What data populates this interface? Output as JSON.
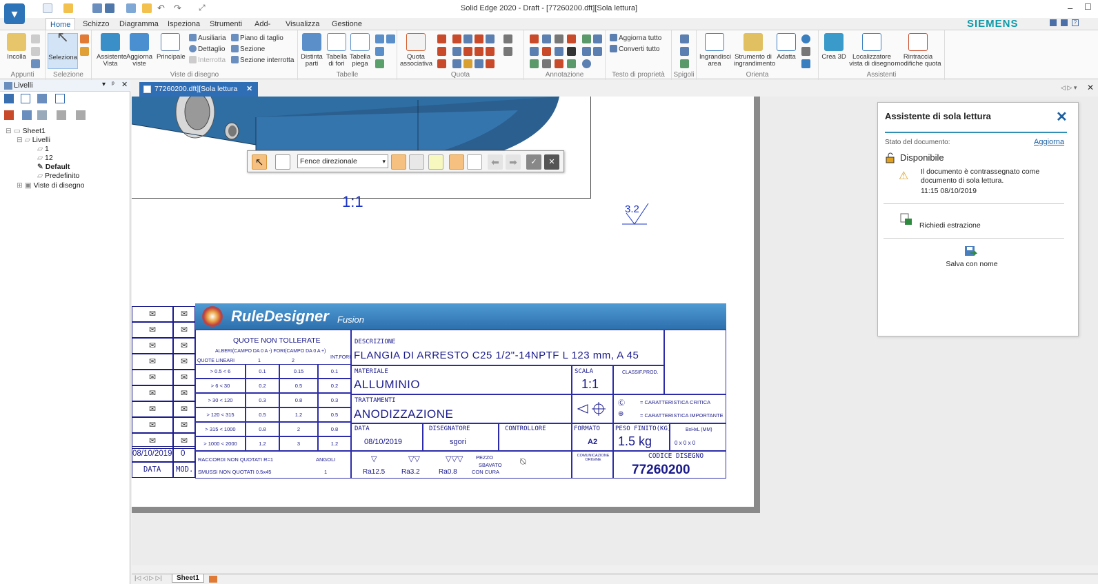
{
  "window": {
    "title": "Solid Edge 2020 - Draft - [77260200.dft][Sola lettura]",
    "brand": "SIEMENS"
  },
  "tabs": [
    "Home",
    "Schizzo",
    "Diagramma",
    "Ispeziona",
    "Strumenti",
    "Add-in",
    "Visualizza",
    "Gestione dati"
  ],
  "ribbon": {
    "appunti": {
      "label": "Appunti",
      "incolla": "Incolla"
    },
    "selezione": {
      "label": "Selezione",
      "seleziona": "Seleziona"
    },
    "viste": {
      "label": "Viste di disegno",
      "assistente": "Assistente Vista",
      "aggiorna": "Aggiorna viste",
      "principale": "Principale",
      "ausiliaria": "Ausiliaria",
      "dettaglio": "Dettaglio",
      "interrotta": "Interrotta",
      "piano": "Piano di taglio",
      "sezione": "Sezione",
      "sez_interrotta": "Sezione interrotta"
    },
    "tabelle": {
      "label": "Tabelle",
      "distinta": "Distinta parti",
      "fori": "Tabella di fori",
      "piega": "Tabella piega"
    },
    "quota": {
      "label": "Quota",
      "associativa": "Quota associativa"
    },
    "annotazione": {
      "label": "Annotazione"
    },
    "testo": {
      "label": "Testo di proprietà",
      "aggiorna_tutto": "Aggiorna tutto",
      "converti_tutto": "Converti tutto"
    },
    "spigoli": {
      "label": "Spigoli"
    },
    "orienta": {
      "label": "Orienta",
      "ingrandisci": "Ingrandisci area",
      "strumento": "Strumento di ingrandimento",
      "adatta": "Adatta"
    },
    "assistenti": {
      "label": "Assistenti",
      "crea3d": "Crea 3D",
      "localizzatore": "Localizzatore vista di disegno",
      "rintraccia": "Rintraccia modifiche quota"
    }
  },
  "layers_panel": {
    "title": "Livelli",
    "tree": [
      "Sheet1",
      "Livelli",
      "1",
      "12",
      "Default",
      "Predefinito",
      "Viste di disegno"
    ]
  },
  "doc_tab": "77260200.dft][Sola lettura",
  "command_bar": {
    "fence": "Fence direzionale"
  },
  "drawing": {
    "view_scale": "1:1",
    "roughness": "3.2",
    "title_block": {
      "logo": "RuleDesigner",
      "logo_sub": "Fusion",
      "tol_title": "QUOTE NON TOLLERATE",
      "tol_sub": "ALBERI(CAMPO DA 0 A -) FORI(CAMPO DA 0 A +)",
      "tol_headers": [
        "QUOTE LINEARI",
        "1",
        "2",
        "INT.FORI"
      ],
      "tol_rows": [
        [
          "> 0.5 < 6",
          "0.1",
          "0.15",
          "0.1"
        ],
        [
          "> 6 < 30",
          "0.2",
          "0.5",
          "0.2"
        ],
        [
          "> 30 < 120",
          "0.3",
          "0.8",
          "0.3"
        ],
        [
          "> 120 < 315",
          "0.5",
          "1.2",
          "0.5"
        ],
        [
          "> 315 < 1000",
          "0.8",
          "2",
          "0.8"
        ],
        [
          "> 1000 < 2000",
          "1.2",
          "3",
          "1.2"
        ]
      ],
      "raccordi": "RACCORDI NON QUOTATI R=1",
      "smussi": "SMUSSI NON QUOTATI 0.5x45",
      "angoli": "ANGOLI",
      "angoli_val": "1",
      "rev_date": "08/10/2019",
      "rev_num": "0",
      "rev_data_lbl": "DATA",
      "rev_mod_lbl": "MOD.",
      "descrizione_lbl": "DESCRIZIONE",
      "descrizione": "FLANGIA DI ARRESTO C25 1/2\"-14NPTF L 123 mm, A 45",
      "materiale_lbl": "MATERIALE",
      "materiale": "ALLUMINIO",
      "scala_lbl": "SCALA",
      "scala": "1:1",
      "classif_lbl": "CLASSIF.PROD.",
      "trattamenti_lbl": "TRATTAMENTI",
      "trattamento": "ANODIZZAZIONE",
      "critica": "= CARATTERISTICA CRITICA",
      "importante": "= CARATTERISTICA IMPORTANTE",
      "data_lbl": "DATA",
      "data": "08/10/2019",
      "disegnatore_lbl": "DISEGNATORE",
      "disegnatore": "sgori",
      "controllore_lbl": "CONTROLLORE",
      "formato_lbl": "FORMATO",
      "formato": "A2",
      "peso_lbl": "PESO FINITO(KG)",
      "peso": "1.5 kg",
      "bxhxl_lbl": "BxHxL (MM)",
      "bxhxl": "0  x  0  x  0",
      "comunicazione": "COMUNICAZIONE ORIGINE",
      "codice_lbl": "CODICE DISEGNO",
      "codice": "77260200",
      "ra": [
        "Ra12.5",
        "Ra3.2",
        "Ra0.8"
      ],
      "pezzo": [
        "PEZZO",
        "SBAVATO",
        "CON CURA"
      ]
    }
  },
  "assistant": {
    "title": "Assistente di sola lettura",
    "state_lbl": "Stato del documento:",
    "refresh": "Aggiorna",
    "status": "Disponibile",
    "message": "Il documento è contrassegnato come documento di sola lettura.",
    "time": "11:15  08/10/2019",
    "request": "Richiedi estrazione",
    "save_as": "Salva con nome"
  },
  "sheet_tab": "Sheet1",
  "colors": {
    "accent": "#2f6db5",
    "drawing_blue": "#1a1a8c",
    "model_blue": "#2e6ea3",
    "brand": "#0a9aa8"
  }
}
